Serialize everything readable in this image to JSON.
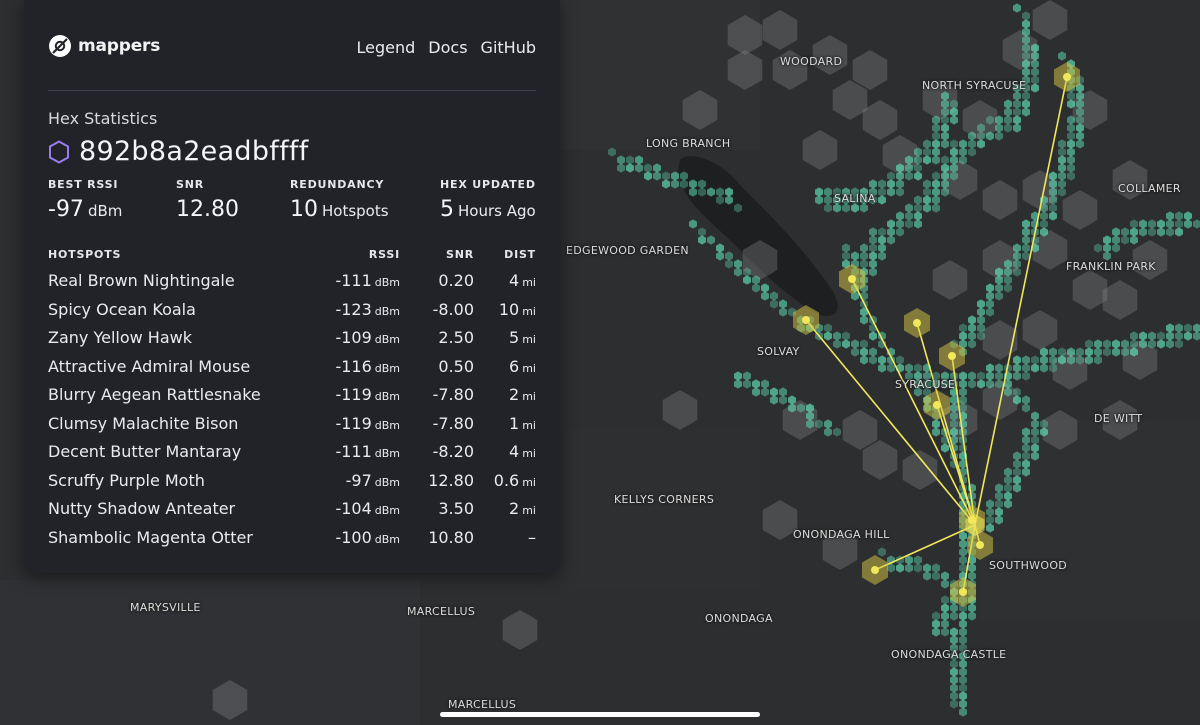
{
  "app": {
    "name": "mappers"
  },
  "nav": [
    "Legend",
    "Docs",
    "GitHub"
  ],
  "panel": {
    "section_title": "Hex Statistics",
    "hex_id": "892b8a2eadbffff",
    "stats": [
      {
        "label": "BEST RSSI",
        "value": "-97",
        "unit": "dBm"
      },
      {
        "label": "SNR",
        "value": "12.80",
        "unit": ""
      },
      {
        "label": "REDUNDANCY",
        "value": "10",
        "unit": "Hotspots"
      },
      {
        "label": "HEX UPDATED",
        "value": "5",
        "unit": "Hours Ago"
      }
    ],
    "table_headers": {
      "hotspots": "HOTSPOTS",
      "rssi": "RSSI",
      "snr": "SNR",
      "dist": "DIST"
    },
    "rssi_unit": "dBm",
    "dist_unit": "mi",
    "hotspots": [
      {
        "name": "Real Brown Nightingale",
        "rssi": "-111",
        "snr": "0.20",
        "dist": "4"
      },
      {
        "name": "Spicy Ocean Koala",
        "rssi": "-123",
        "snr": "-8.00",
        "dist": "10"
      },
      {
        "name": "Zany Yellow Hawk",
        "rssi": "-109",
        "snr": "2.50",
        "dist": "5"
      },
      {
        "name": "Attractive Admiral Mouse",
        "rssi": "-116",
        "snr": "0.50",
        "dist": "6"
      },
      {
        "name": "Blurry Aegean Rattlesnake",
        "rssi": "-119",
        "snr": "-7.80",
        "dist": "2"
      },
      {
        "name": "Clumsy Malachite Bison",
        "rssi": "-119",
        "snr": "-7.80",
        "dist": "1"
      },
      {
        "name": "Decent Butter Mantaray",
        "rssi": "-111",
        "snr": "-8.20",
        "dist": "4"
      },
      {
        "name": "Scruffy Purple Moth",
        "rssi": "-97",
        "snr": "12.80",
        "dist": "0.6"
      },
      {
        "name": "Nutty Shadow Anteater",
        "rssi": "-104",
        "snr": "3.50",
        "dist": "2"
      },
      {
        "name": "Shambolic Magenta Otter",
        "rssi": "-100",
        "snr": "10.80",
        "dist": "–"
      }
    ]
  },
  "map": {
    "labels": [
      "WOODARD",
      "NORTH SYRACUSE",
      "LONG BRANCH",
      "COLLAMER",
      "SALINA",
      "EDGEWOOD GARDEN",
      "FRANKLIN PARK",
      "SOLVAY",
      "SYRACUSE",
      "DE WITT",
      "KELLYS CORNERS",
      "ONONDAGA HILL",
      "SOUTHWOOD",
      "MARYSVILLE",
      "MARCELLUS",
      "ONONDAGA",
      "ONONDAGA CASTLE",
      "MARCELLUS"
    ],
    "colors": {
      "coverage": "#5fe0b8",
      "link": "#f0e85a",
      "hex_grey": "#8a8c90",
      "hex_purple": "#9b7bf0"
    }
  }
}
